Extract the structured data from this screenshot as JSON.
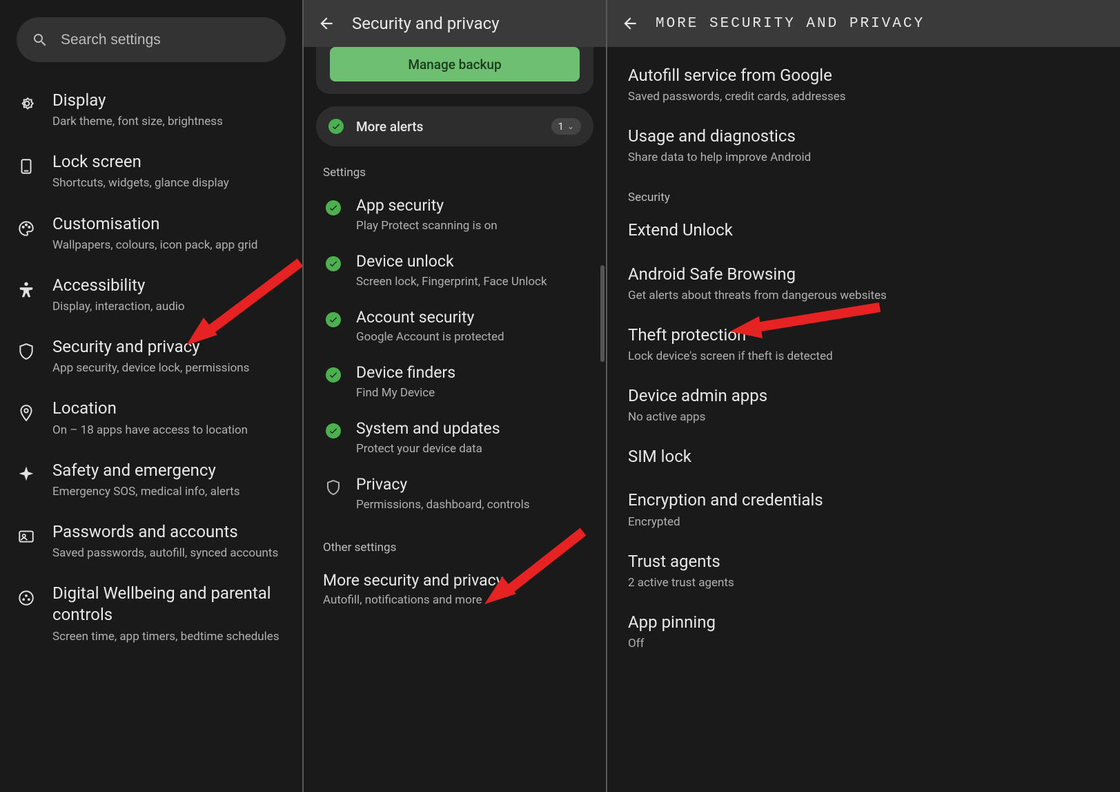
{
  "panel1": {
    "search_placeholder": "Search settings",
    "items": [
      {
        "title": "Display",
        "subtitle": "Dark theme, font size, brightness"
      },
      {
        "title": "Lock screen",
        "subtitle": "Shortcuts, widgets, glance display"
      },
      {
        "title": "Customisation",
        "subtitle": "Wallpapers, colours, icon pack, app grid"
      },
      {
        "title": "Accessibility",
        "subtitle": "Display, interaction, audio"
      },
      {
        "title": "Security and privacy",
        "subtitle": "App security, device lock, permissions"
      },
      {
        "title": "Location",
        "subtitle": "On – 18 apps have access to location"
      },
      {
        "title": "Safety and emergency",
        "subtitle": "Emergency SOS, medical info, alerts"
      },
      {
        "title": "Passwords and accounts",
        "subtitle": "Saved passwords, autofill, synced accounts"
      },
      {
        "title": "Digital Wellbeing and parental controls",
        "subtitle": "Screen time, app timers, bedtime schedules"
      }
    ]
  },
  "panel2": {
    "title": "Security and privacy",
    "manage_backup": "Manage backup",
    "more_alerts": "More alerts",
    "alert_count": "1",
    "sections": {
      "settings": "Settings",
      "other": "Other settings"
    },
    "items": [
      {
        "title": "App security",
        "subtitle": "Play Protect scanning is on"
      },
      {
        "title": "Device unlock",
        "subtitle": "Screen lock, Fingerprint, Face Unlock"
      },
      {
        "title": "Account security",
        "subtitle": "Google Account is protected"
      },
      {
        "title": "Device finders",
        "subtitle": "Find My Device"
      },
      {
        "title": "System and updates",
        "subtitle": "Protect your device data"
      },
      {
        "title": "Privacy",
        "subtitle": "Permissions, dashboard, controls"
      }
    ],
    "more_item": {
      "title": "More security and privacy",
      "subtitle": "Autofill, notifications and more"
    }
  },
  "panel3": {
    "title": "MORE SECURITY AND PRIVACY",
    "top_items": [
      {
        "title": "Autofill service from Google",
        "subtitle": "Saved passwords, credit cards, addresses"
      },
      {
        "title": "Usage and diagnostics",
        "subtitle": "Share data to help improve Android"
      }
    ],
    "section": "Security",
    "sec_items": [
      {
        "title": "Extend Unlock",
        "subtitle": ""
      },
      {
        "title": "Android Safe Browsing",
        "subtitle": "Get alerts about threats from dangerous websites"
      },
      {
        "title": "Theft protection",
        "subtitle": "Lock device's screen if theft is detected"
      },
      {
        "title": "Device admin apps",
        "subtitle": "No active apps"
      },
      {
        "title": "SIM lock",
        "subtitle": ""
      },
      {
        "title": "Encryption and credentials",
        "subtitle": "Encrypted"
      },
      {
        "title": "Trust agents",
        "subtitle": "2 active trust agents"
      },
      {
        "title": "App pinning",
        "subtitle": "Off"
      }
    ]
  }
}
